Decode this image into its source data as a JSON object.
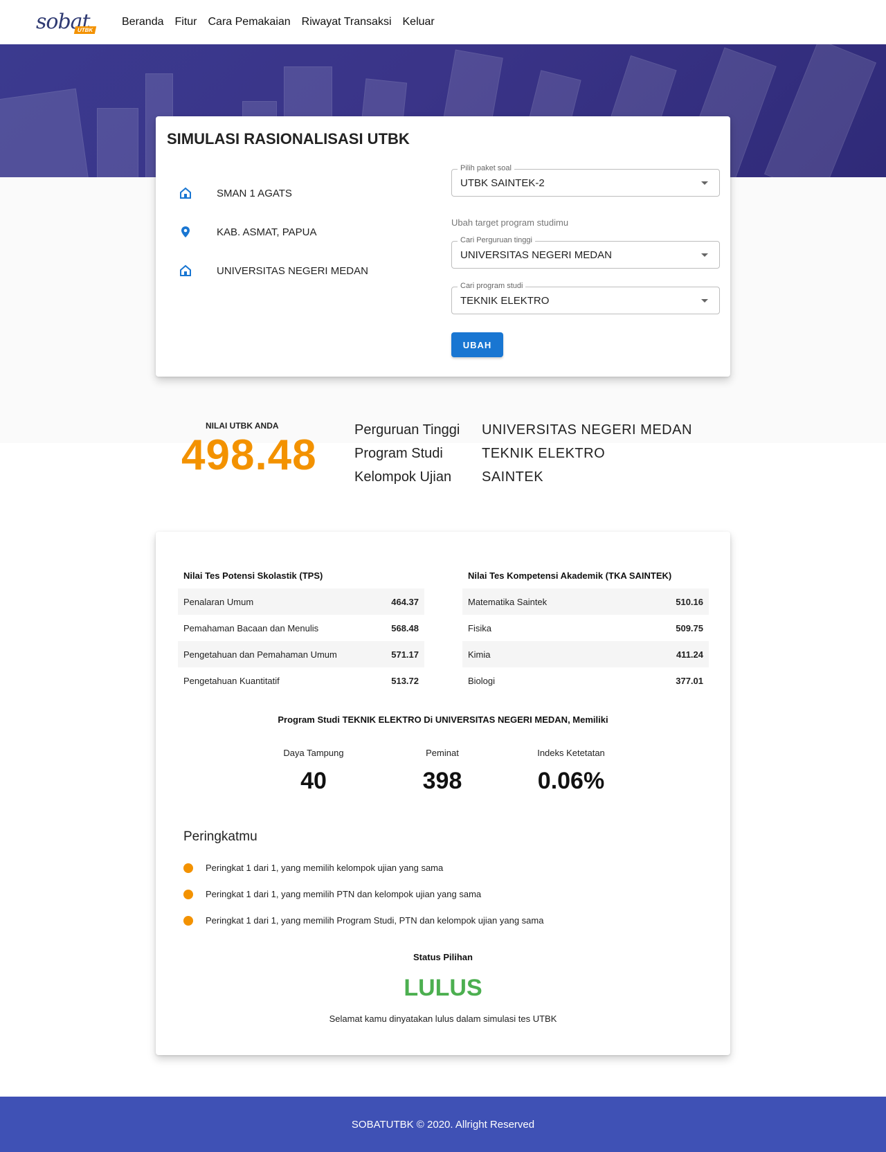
{
  "brand": {
    "script": "sobat",
    "badge": "UTBK"
  },
  "nav": {
    "items": [
      {
        "label": "Beranda"
      },
      {
        "label": "Fitur"
      },
      {
        "label": "Cara Pemakaian"
      },
      {
        "label": "Riwayat Transaksi"
      },
      {
        "label": "Keluar"
      }
    ]
  },
  "simulasi": {
    "title": "SIMULASI RASIONALISASI UTBK",
    "school": "SMAN 1 AGATS",
    "location": "KAB. ASMAT, PAPUA",
    "target_university": "UNIVERSITAS NEGERI MEDAN",
    "paket": {
      "legend": "Pilih paket soal",
      "value": "UTBK SAINTEK-2"
    },
    "ubah_label": "Ubah target program studimu",
    "ptn": {
      "legend": "Cari Perguruan tinggi",
      "value": "UNIVERSITAS NEGERI MEDAN"
    },
    "prodi": {
      "legend": "Cari program studi",
      "value": "TEKNIK ELEKTRO"
    },
    "button": "UBAH"
  },
  "score": {
    "label": "NILAI UTBK ANDA",
    "value": "498.48",
    "summary": [
      {
        "key": "Perguruan Tinggi",
        "value": "UNIVERSITAS NEGERI MEDAN"
      },
      {
        "key": "Program Studi",
        "value": "TEKNIK ELEKTRO"
      },
      {
        "key": "Kelompok Ujian",
        "value": "SAINTEK"
      }
    ]
  },
  "tps": {
    "title": "Nilai Tes Potensi Skolastik (TPS)",
    "rows": [
      {
        "label": "Penalaran Umum",
        "value": "464.37"
      },
      {
        "label": "Pemahaman Bacaan dan Menulis",
        "value": "568.48"
      },
      {
        "label": "Pengetahuan dan Pemahaman Umum",
        "value": "571.17"
      },
      {
        "label": "Pengetahuan Kuantitatif",
        "value": "513.72"
      }
    ]
  },
  "tka": {
    "title": "Nilai Tes Kompetensi Akademik (TKA SAINTEK)",
    "rows": [
      {
        "label": "Matematika Saintek",
        "value": "510.16"
      },
      {
        "label": "Fisika",
        "value": "509.75"
      },
      {
        "label": "Kimia",
        "value": "411.24"
      },
      {
        "label": "Biologi",
        "value": "377.01"
      }
    ]
  },
  "prodi_info": {
    "title": "Program Studi TEKNIK ELEKTRO Di UNIVERSITAS NEGERI MEDAN, Memiliki",
    "stats": [
      {
        "label": "Daya Tampung",
        "value": "40"
      },
      {
        "label": "Peminat",
        "value": "398"
      },
      {
        "label": "Indeks Ketetatan",
        "value": "0.06%"
      }
    ]
  },
  "ranking": {
    "title": "Peringkatmu",
    "items": [
      "Peringkat 1 dari 1, yang memilih kelompok ujian yang sama",
      "Peringkat 1 dari 1, yang memilih PTN dan kelompok ujian yang sama",
      "Peringkat 1 dari 1, yang memilih Program Studi, PTN dan kelompok ujian yang sama"
    ]
  },
  "status": {
    "label": "Status Pilihan",
    "value": "LULUS",
    "description": "Selamat kamu dinyatakan lulus dalam simulasi tes UTBK"
  },
  "footer": {
    "text": "SOBATUTBK © 2020. Allright Reserved"
  },
  "colors": {
    "accent": "#f39200",
    "primary": "#1976d2",
    "success": "#4caf50",
    "footer": "#3f51b5",
    "hero": "#3b3a8f"
  }
}
